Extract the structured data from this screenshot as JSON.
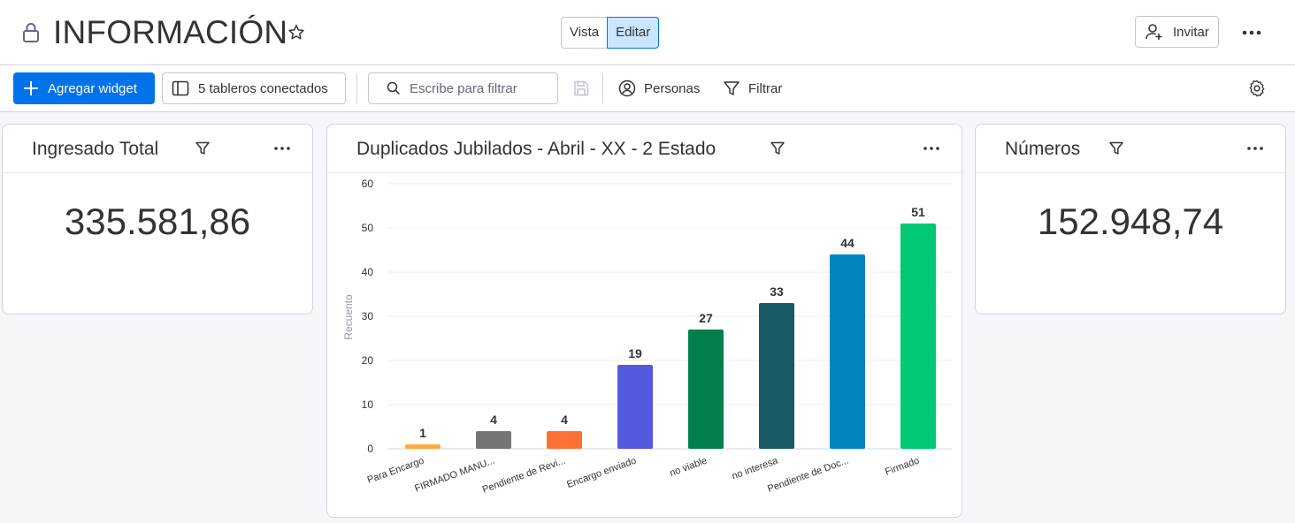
{
  "header": {
    "title": "INFORMACIÓN",
    "view_toggle": {
      "view_label": "Vista",
      "edit_label": "Editar",
      "selected": "Editar"
    },
    "invite_label": "Invitar"
  },
  "toolbar": {
    "add_widget_label": "Agregar widget",
    "connected_boards_label": "5 tableros conectados",
    "search_placeholder": "Escribe para filtrar",
    "people_label": "Personas",
    "filter_label": "Filtrar"
  },
  "colors": {
    "accent": "#0073ea",
    "toggle_selected_bg": "#cce5ff",
    "canvas_bg": "#f6f7fb"
  },
  "widgets": {
    "total": {
      "title": "Ingresado Total",
      "value": "335.581,86"
    },
    "numbers": {
      "title": "Números",
      "value": "152.948,74"
    },
    "chart": {
      "title": "Duplicados Jubilados - Abril - XX - 2 Estado"
    }
  },
  "chart_data": {
    "type": "bar",
    "ylabel": "Recuento",
    "xlabel": "",
    "ylim": [
      0,
      60
    ],
    "yticks": [
      0,
      10,
      20,
      30,
      40,
      50,
      60
    ],
    "grid": true,
    "categories": [
      "Para Encargo",
      "FIRMADO MANU...",
      "Pendiente de Revi...",
      "Encargo enviado",
      "no viable",
      "no interesa",
      "Pendiente de Doc...",
      "Firmado"
    ],
    "values": [
      1,
      4,
      4,
      19,
      27,
      33,
      44,
      51
    ],
    "colors": [
      "#fdab3d",
      "#757575",
      "#ff7133",
      "#5559df",
      "#037f4c",
      "#175a63",
      "#0086c0",
      "#00c875"
    ]
  }
}
